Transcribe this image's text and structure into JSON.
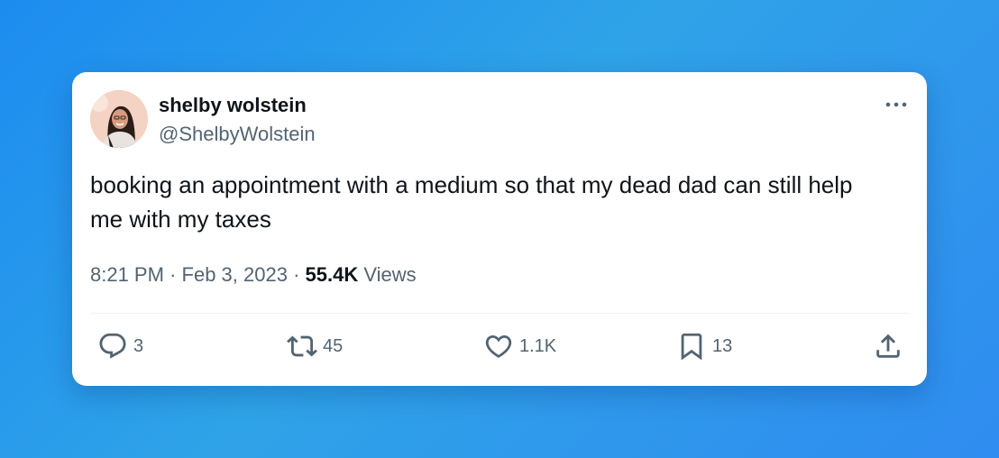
{
  "tweet": {
    "display_name": "shelby wolstein",
    "handle": "@ShelbyWolstein",
    "text": "booking an appointment with a medium so that my dead dad can still help me with my taxes",
    "time": "8:21 PM",
    "date": "Feb 3, 2023",
    "views_count": "55.4K",
    "views_label": "Views",
    "separator": "·"
  },
  "actions": {
    "replies": "3",
    "retweets": "45",
    "likes": "1.1K",
    "bookmarks": "13"
  },
  "colors": {
    "text_primary": "#0f1419",
    "text_secondary": "#536471",
    "background_gradient_start": "#1d8cf0",
    "card_background": "#ffffff"
  },
  "icons": {
    "reply": "reply-icon",
    "retweet": "retweet-icon",
    "like": "heart-icon",
    "bookmark": "bookmark-icon",
    "share": "share-icon",
    "more": "more-icon"
  }
}
